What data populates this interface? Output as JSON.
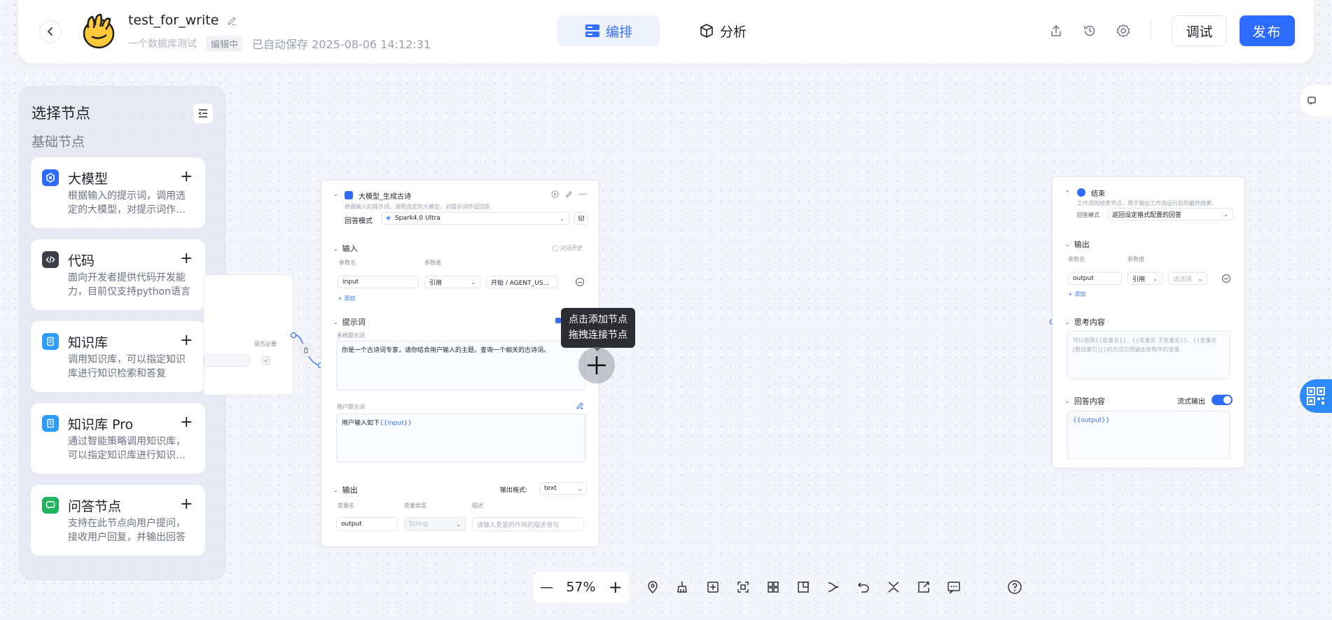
{
  "header": {
    "title": "test_for_write",
    "description": "一个数据库测试",
    "status": "编辑中",
    "saved_text": "已自动保存 2025-08-06 14:12:31",
    "tabs": [
      {
        "label": "编排",
        "active": true
      },
      {
        "label": "分析",
        "active": false
      }
    ],
    "debug_label": "调试",
    "publish_label": "发布"
  },
  "panel": {
    "title": "选择节点",
    "section": "基础节点",
    "nodes": [
      {
        "name": "大模型",
        "desc": "根据输入的提示词，调用选定的大模型，对提示词作出回答",
        "icon": "llm-icon",
        "color": "#2f6bff"
      },
      {
        "name": "代码",
        "desc": "面向开发者提供代码开发能力，目前仅支持python语言",
        "icon": "code-icon",
        "color": "#3b3f48"
      },
      {
        "name": "知识库",
        "desc": "调用知识库，可以指定知识库进行知识检索和答复",
        "icon": "knowledge-icon",
        "color": "#2e9bff"
      },
      {
        "name": "知识库 Pro",
        "desc": "通过智能策略调用知识库，可以指定知识库进行知识检索",
        "icon": "knowledge-pro-icon",
        "color": "#2e9bff"
      },
      {
        "name": "问答节点",
        "desc": "支持在此节点向用户提问，接收用户回复，并输出回答",
        "icon": "qa-icon",
        "color": "#22b35e"
      }
    ]
  },
  "partial_node": {
    "required_label": "是否必要"
  },
  "llm_node": {
    "title": "大模型_生成古诗",
    "subtitle": "根据输入的提示词，调用选定的大模型，对提示词作出回答",
    "mode_label": "回答模式",
    "model": "Spark4.0 Ultra",
    "input_section": "输入",
    "history_label": "对话历史",
    "param_name_label": "参数名",
    "param_value_label": "参数值",
    "input_name": "input",
    "input_type": "引用",
    "input_ref": "开始 / AGENT_US...",
    "add_label": "添加",
    "prompt_section": "提示词",
    "system_prompt_label": "系统提示词",
    "system_prompt": "你是一个古诗词专家，请你结合用户输入的主题，查询一个相关的古诗词。",
    "user_prompt_label": "用户提示词",
    "user_prompt_prefix": "用户输入如下",
    "user_prompt_var": "{{input}}",
    "output_section": "输出",
    "output_format_label": "输出格式:",
    "output_format": "text",
    "var_name_label": "变量名",
    "var_type_label": "变量类型",
    "desc_label": "描述",
    "output_name": "output",
    "output_type": "String",
    "desc_placeholder": "请输入变量的作用的描述语句"
  },
  "tooltip": {
    "line1": "点击添加节点",
    "line2": "拖拽连接节点"
  },
  "end_node": {
    "title": "结束",
    "subtitle": "工作流的结束节点，用于输出工作流运行后的最终结果。",
    "mode_label": "回答模式",
    "mode_value": "返回设定格式配置的回答",
    "output_section": "输出",
    "param_name_label": "参数名",
    "param_value_label": "参数值",
    "output_name": "output",
    "output_type": "引用",
    "output_placeholder": "请选择",
    "add_label": "添加",
    "think_section": "思考内容",
    "think_placeholder": "可以使用{{变量名}}、{{变量名.子变量名}}、{{变量名[数组索引]}}的方式引用输出参数中的变量",
    "answer_section": "回答内容",
    "stream_label": "流式输出",
    "stream_on": true,
    "answer_value": "{{output}}"
  },
  "toolbar": {
    "zoom": "57%",
    "tools": [
      "locate-icon",
      "clean-icon",
      "add-note-icon",
      "fit-view-icon",
      "layout-icon",
      "minimap-icon",
      "connector-icon",
      "undo-icon",
      "collapse-icon",
      "export-icon",
      "comment-icon",
      "help-icon"
    ]
  },
  "colors": {
    "accent": "#2e6bff",
    "tab_active_bg": "#eef2fd",
    "tooltip_bg": "#2b2d33"
  }
}
